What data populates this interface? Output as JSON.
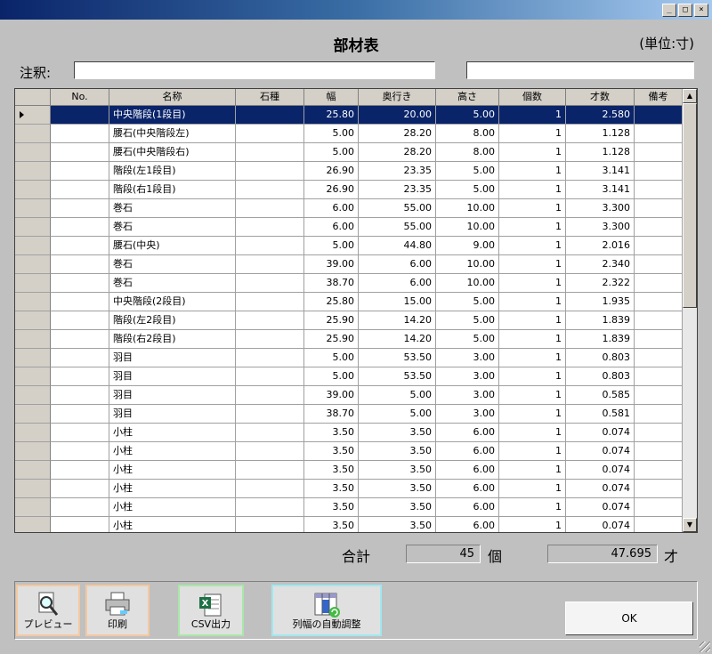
{
  "window": {
    "buttons": [
      "_",
      "□",
      "×"
    ]
  },
  "title": "部材表",
  "unit": "(単位:寸)",
  "note": {
    "label": "注釈:",
    "value1": "",
    "value2": ""
  },
  "columns": [
    "No.",
    "名称",
    "石種",
    "幅",
    "奥行き",
    "高さ",
    "個数",
    "才数",
    "備考"
  ],
  "rows": [
    [
      "",
      "中央階段(1段目)",
      "",
      "25.80",
      "20.00",
      "5.00",
      "1",
      "2.580",
      ""
    ],
    [
      "",
      "腰石(中央階段左)",
      "",
      "5.00",
      "28.20",
      "8.00",
      "1",
      "1.128",
      ""
    ],
    [
      "",
      "腰石(中央階段右)",
      "",
      "5.00",
      "28.20",
      "8.00",
      "1",
      "1.128",
      ""
    ],
    [
      "",
      "階段(左1段目)",
      "",
      "26.90",
      "23.35",
      "5.00",
      "1",
      "3.141",
      ""
    ],
    [
      "",
      "階段(右1段目)",
      "",
      "26.90",
      "23.35",
      "5.00",
      "1",
      "3.141",
      ""
    ],
    [
      "",
      "巻石",
      "",
      "6.00",
      "55.00",
      "10.00",
      "1",
      "3.300",
      ""
    ],
    [
      "",
      "巻石",
      "",
      "6.00",
      "55.00",
      "10.00",
      "1",
      "3.300",
      ""
    ],
    [
      "",
      "腰石(中央)",
      "",
      "5.00",
      "44.80",
      "9.00",
      "1",
      "2.016",
      ""
    ],
    [
      "",
      "巻石",
      "",
      "39.00",
      "6.00",
      "10.00",
      "1",
      "2.340",
      ""
    ],
    [
      "",
      "巻石",
      "",
      "38.70",
      "6.00",
      "10.00",
      "1",
      "2.322",
      ""
    ],
    [
      "",
      "中央階段(2段目)",
      "",
      "25.80",
      "15.00",
      "5.00",
      "1",
      "1.935",
      ""
    ],
    [
      "",
      "階段(左2段目)",
      "",
      "25.90",
      "14.20",
      "5.00",
      "1",
      "1.839",
      ""
    ],
    [
      "",
      "階段(右2段目)",
      "",
      "25.90",
      "14.20",
      "5.00",
      "1",
      "1.839",
      ""
    ],
    [
      "",
      "羽目",
      "",
      "5.00",
      "53.50",
      "3.00",
      "1",
      "0.803",
      ""
    ],
    [
      "",
      "羽目",
      "",
      "5.00",
      "53.50",
      "3.00",
      "1",
      "0.803",
      ""
    ],
    [
      "",
      "羽目",
      "",
      "39.00",
      "5.00",
      "3.00",
      "1",
      "0.585",
      ""
    ],
    [
      "",
      "羽目",
      "",
      "38.70",
      "5.00",
      "3.00",
      "1",
      "0.581",
      ""
    ],
    [
      "",
      "小柱",
      "",
      "3.50",
      "3.50",
      "6.00",
      "1",
      "0.074",
      ""
    ],
    [
      "",
      "小柱",
      "",
      "3.50",
      "3.50",
      "6.00",
      "1",
      "0.074",
      ""
    ],
    [
      "",
      "小柱",
      "",
      "3.50",
      "3.50",
      "6.00",
      "1",
      "0.074",
      ""
    ],
    [
      "",
      "小柱",
      "",
      "3.50",
      "3.50",
      "6.00",
      "1",
      "0.074",
      ""
    ],
    [
      "",
      "小柱",
      "",
      "3.50",
      "3.50",
      "6.00",
      "1",
      "0.074",
      ""
    ],
    [
      "",
      "小柱",
      "",
      "3.50",
      "3.50",
      "6.00",
      "1",
      "0.074",
      ""
    ]
  ],
  "totals": {
    "label": "合計",
    "count": "45",
    "count_unit": "個",
    "sai": "47.695",
    "sai_unit": "才"
  },
  "toolbar": {
    "preview": "プレビュー",
    "print": "印刷",
    "csv": "CSV出力",
    "autofit": "列幅の自動調整",
    "ok": "OK"
  },
  "colors": {
    "selection": "#0a246a",
    "preview_border": "#f5c8a0",
    "csv_border": "#a8e8a8",
    "autofit_border": "#a0e8f0"
  }
}
